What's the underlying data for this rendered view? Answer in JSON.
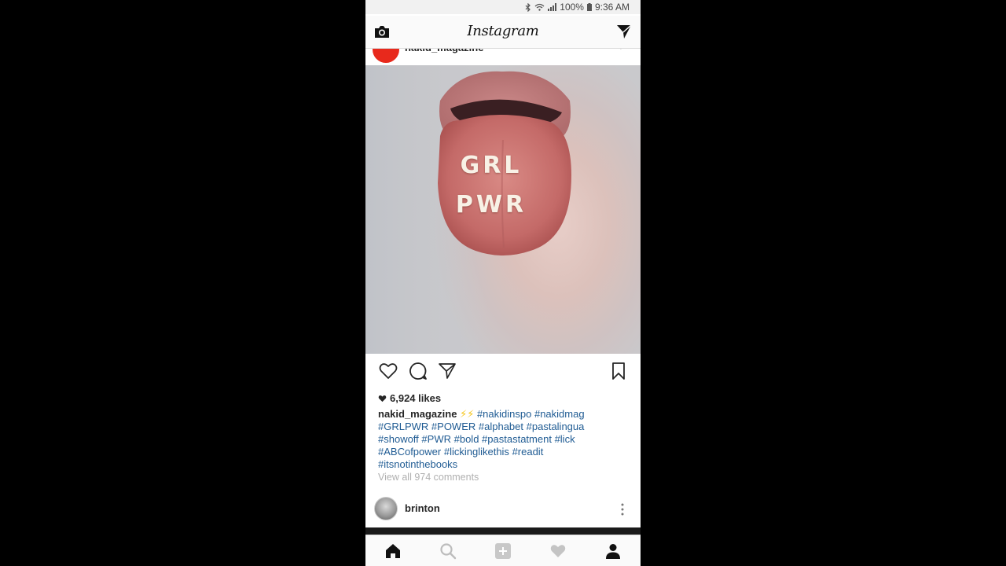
{
  "status_bar": {
    "battery": "100%",
    "time": "9:36 AM"
  },
  "app": {
    "title": "Instagram"
  },
  "post": {
    "username": "nakid_magazine",
    "image_text": [
      "GRL",
      "PWR"
    ],
    "likes": "6,924 likes",
    "caption_user": "nakid_magazine",
    "caption_emoji": "⚡⚡",
    "hashtags": [
      "#nakidinspo",
      "#nakidmag",
      "#GRLPWR",
      "#POWER",
      "#alphabet",
      "#pastalingua",
      "#showoff",
      "#PWR",
      "#bold",
      "#pastastatment",
      "#lick",
      "#ABCofpower",
      "#lickinglikethis",
      "#readit",
      "#itsnotinthebooks"
    ],
    "view_comments": "View all 974 comments"
  },
  "next_post": {
    "username": "brinton"
  },
  "icons": {
    "camera": "camera-icon",
    "direct": "direct-message-icon",
    "like": "heart-outline-icon",
    "comment": "comment-icon",
    "share": "share-icon",
    "save": "bookmark-icon",
    "home": "home-icon",
    "search": "search-icon",
    "add": "add-post-icon",
    "activity": "heart-icon",
    "profile": "profile-icon"
  }
}
